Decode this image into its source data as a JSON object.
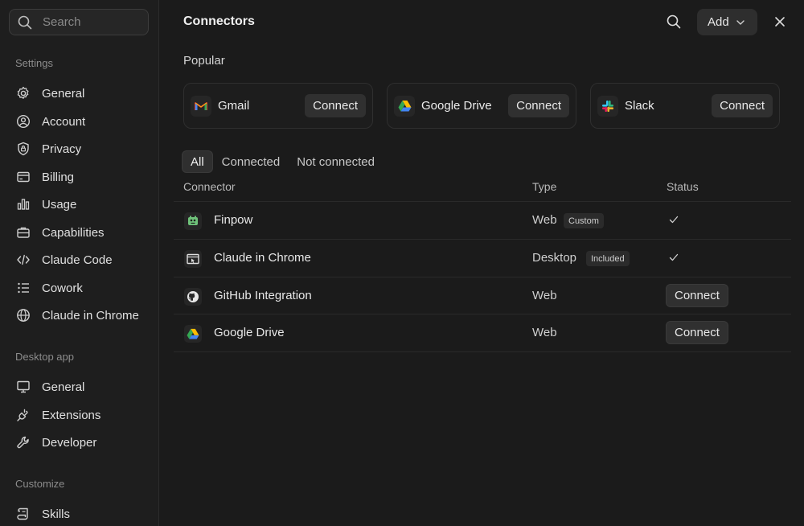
{
  "sidebar": {
    "search_placeholder": "Search",
    "sections": {
      "settings": "Settings",
      "desktop": "Desktop app",
      "customize": "Customize"
    },
    "settings_items": [
      {
        "label": "General",
        "icon": "gear-icon"
      },
      {
        "label": "Account",
        "icon": "user-circle-icon"
      },
      {
        "label": "Privacy",
        "icon": "shield-lock-icon"
      },
      {
        "label": "Billing",
        "icon": "credit-card-icon"
      },
      {
        "label": "Usage",
        "icon": "bar-chart-icon"
      },
      {
        "label": "Capabilities",
        "icon": "briefcase-icon"
      },
      {
        "label": "Claude Code",
        "icon": "code-icon"
      },
      {
        "label": "Cowork",
        "icon": "list-icon"
      },
      {
        "label": "Claude in Chrome",
        "icon": "globe-icon"
      }
    ],
    "desktop_items": [
      {
        "label": "General",
        "icon": "monitor-icon"
      },
      {
        "label": "Extensions",
        "icon": "plug-icon"
      },
      {
        "label": "Developer",
        "icon": "wrench-icon"
      }
    ],
    "customize_items": [
      {
        "label": "Skills",
        "icon": "scroll-icon"
      }
    ]
  },
  "header": {
    "title": "Connectors",
    "add_label": "Add"
  },
  "popular": {
    "label": "Popular",
    "cards": [
      {
        "name": "Gmail",
        "button": "Connect",
        "icon": "gmail-icon"
      },
      {
        "name": "Google Drive",
        "button": "Connect",
        "icon": "google-drive-icon"
      },
      {
        "name": "Slack",
        "button": "Connect",
        "icon": "slack-icon"
      }
    ]
  },
  "filters": [
    "All",
    "Connected",
    "Not connected"
  ],
  "table": {
    "headers": {
      "connector": "Connector",
      "type": "Type",
      "status": "Status"
    },
    "rows": [
      {
        "name": "Finpow",
        "type": "Web",
        "badge": "Custom",
        "status": "connected",
        "icon": "finpow-icon"
      },
      {
        "name": "Claude in Chrome",
        "type": "Desktop",
        "badge": "Included",
        "status": "connected",
        "icon": "chrome-extension-icon"
      },
      {
        "name": "GitHub Integration",
        "type": "Web",
        "badge": "",
        "status": "Connect",
        "icon": "github-icon"
      },
      {
        "name": "Google Drive",
        "type": "Web",
        "badge": "",
        "status": "Connect",
        "icon": "google-drive-icon"
      }
    ]
  },
  "colors": {
    "background": "#1b1b1b",
    "sidebar": "#1e1e1e",
    "button": "#303030",
    "text": "#e6e6e6"
  }
}
